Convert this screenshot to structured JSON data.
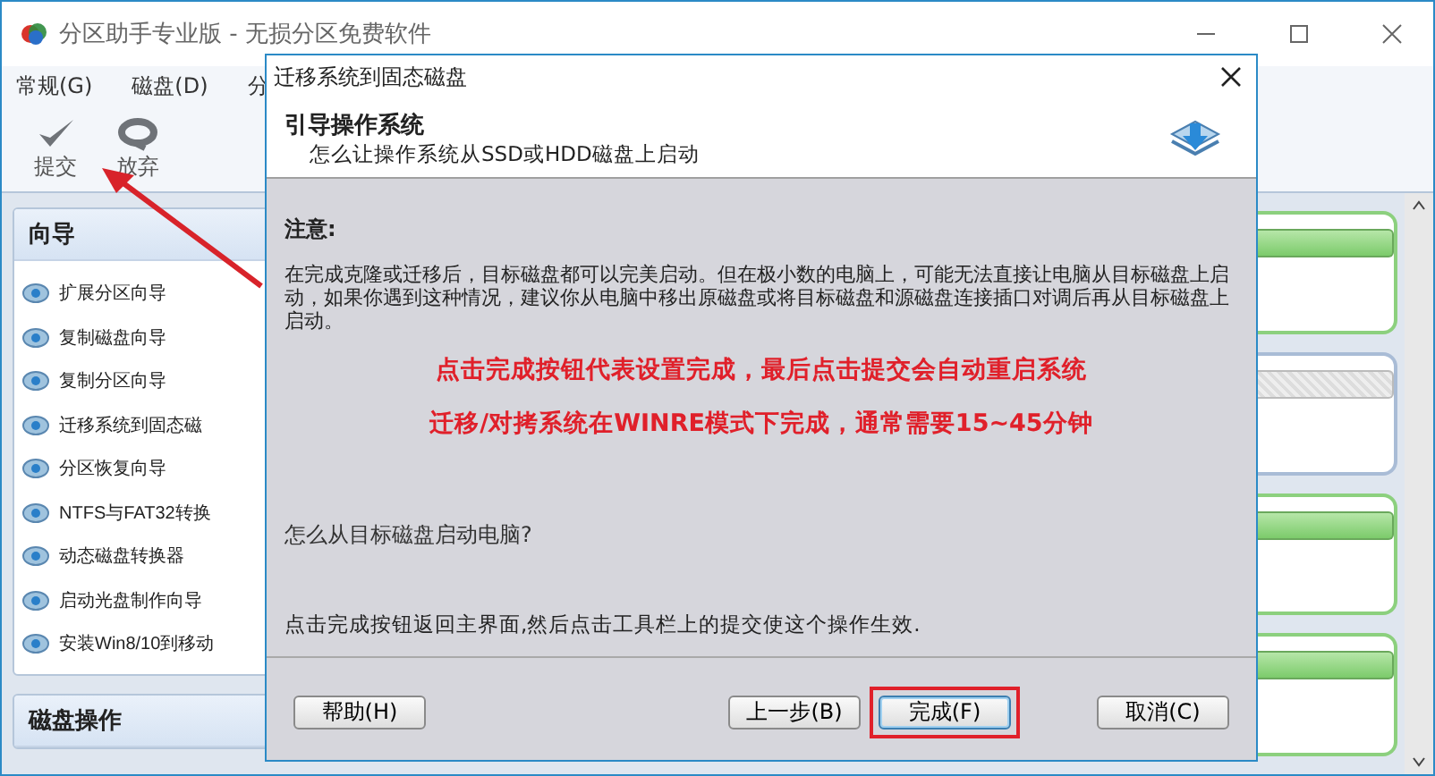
{
  "window": {
    "title": "分区助手专业版 - 无损分区免费软件"
  },
  "menu": [
    "常规(G)",
    "磁盘(D)",
    "分"
  ],
  "toolbar": [
    {
      "label": "提交",
      "kind": "check"
    },
    {
      "label": "放弃",
      "kind": "discard"
    }
  ],
  "sidebar": [
    {
      "title": "向导",
      "items": [
        "扩展分区向导",
        "复制磁盘向导",
        "复制分区向导",
        "迁移系统到固态磁",
        "分区恢复向导",
        "NTFS与FAT32转换",
        "动态磁盘转换器",
        "启动光盘制作向导",
        "安装Win8/10到移动"
      ]
    },
    {
      "title": "磁盘操作"
    }
  ],
  "disk_cards": [
    {
      "kind": "partition"
    },
    {
      "kind": "unallocated"
    },
    {
      "kind": "partition"
    },
    {
      "kind": "partition"
    }
  ],
  "dialog": {
    "title": "迁移系统到固态磁盘",
    "heading": "引导操作系统",
    "subheading": "怎么让操作系统从SSD或HDD磁盘上启动",
    "notice_label": "注意:",
    "notice": "在完成克隆或迁移后，目标磁盘都可以完美启动。但在极小数的电脑上，可能无法直接让电脑从目标磁盘上启动，如果你遇到这种情况，建议你从电脑中移出原磁盘或将目标磁盘和源磁盘连接插口对调后再从目标磁盘上启动。",
    "highlights": [
      "点击完成按钮代表设置完成，最后点击提交会自动重启系统",
      "迁移/对拷系统在WINRE模式下完成，通常需要15~45分钟"
    ],
    "question": "怎么从目标磁盘启动电脑?",
    "instruction": "点击完成按钮返回主界面,然后点击工具栏上的提交使这个操作生效.",
    "buttons": [
      {
        "label": "帮助(H)",
        "kind": "help",
        "highlighted": false
      },
      {
        "label": "上一步(B)",
        "kind": "back",
        "highlighted": false
      },
      {
        "label": "完成(F)",
        "kind": "finish",
        "highlighted": true
      },
      {
        "label": "取消(C)",
        "kind": "cancel",
        "highlighted": false
      }
    ]
  }
}
